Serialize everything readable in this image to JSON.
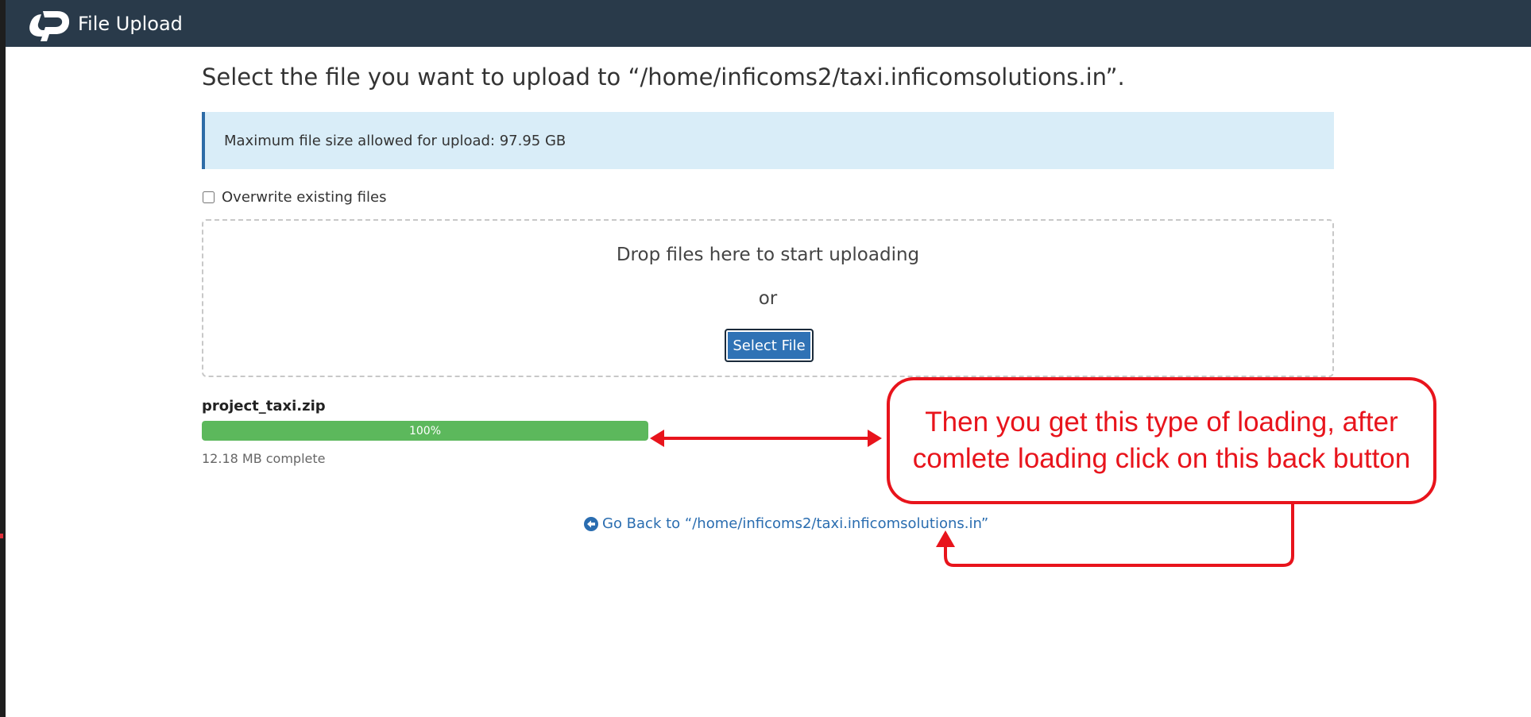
{
  "header": {
    "app_title": "File Upload",
    "logo_icon": "cpanel-logo-icon",
    "background": "#293a4a"
  },
  "main": {
    "heading": "Select the file you want to upload to “/home/inficoms2/taxi.inficomsolutions.in”.",
    "max_size_notice": "Maximum file size allowed for upload: 97.95 GB",
    "overwrite_label": "Overwrite existing files",
    "overwrite_checked": false,
    "dropzone": {
      "text": "Drop files here to start uploading",
      "or": "or",
      "select_button": "Select File"
    },
    "upload": {
      "filename": "project_taxi.zip",
      "progress_percent": 100,
      "progress_label": "100%",
      "status": "12.18 MB complete"
    },
    "back_link": {
      "icon": "arrow-circle-left-icon",
      "text": "Go Back to “/home/inficoms2/taxi.inficomsolutions.in”"
    }
  },
  "annotation": {
    "text": "Then you get this type of loading, after comlete loading click on this back button",
    "color": "#e8141c"
  },
  "colors": {
    "accent": "#2f72b5",
    "progress": "#5cb85c",
    "info_bg": "#d9edf8",
    "link": "#2a6db0"
  }
}
